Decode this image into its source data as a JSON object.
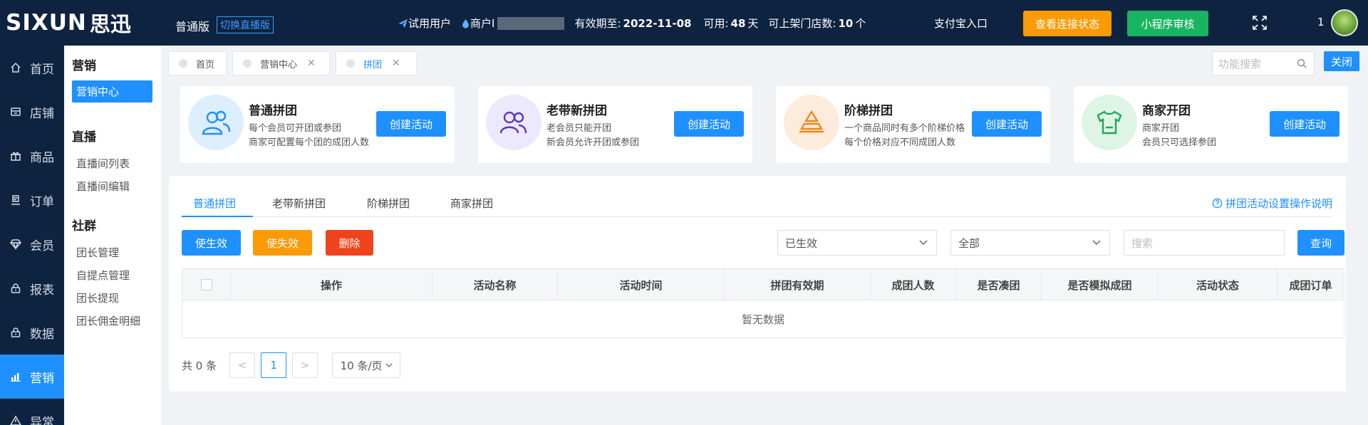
{
  "header": {
    "logo_text": "SIXUN",
    "logo_cn": "思迅",
    "edition": "普通版",
    "switch_link": "切换直播版",
    "trial_user": "试用用户",
    "merchant_label": "商户I",
    "expiry_label": "有效期至:",
    "expiry_value": "2022-11-08",
    "available_label": "可用:",
    "available_value": "48",
    "available_unit": "天",
    "stores_label": "可上架门店数:",
    "stores_value": "10",
    "stores_unit": "个",
    "alipay_entry": "支付宝入口",
    "status_button": "查看连接状态",
    "miniprogram_button": "小程序审核",
    "user_number": "1"
  },
  "sidenav": [
    {
      "label": "首页",
      "icon": "home-icon"
    },
    {
      "label": "店铺",
      "icon": "store-icon"
    },
    {
      "label": "商品",
      "icon": "gift-icon"
    },
    {
      "label": "订单",
      "icon": "order-icon"
    },
    {
      "label": "会员",
      "icon": "diamond-icon"
    },
    {
      "label": "报表",
      "icon": "lock-icon"
    },
    {
      "label": "数据",
      "icon": "lock-icon"
    },
    {
      "label": "营销",
      "icon": "bar-chart-icon",
      "active": true
    },
    {
      "label": "异常",
      "icon": "warning-icon"
    }
  ],
  "subnav": {
    "group1": "营销",
    "marketing_center": "营销中心",
    "group2": "直播",
    "live_list": "直播间列表",
    "live_edit": "直播间编辑",
    "group3": "社群",
    "leader_manage": "团长管理",
    "pickup_manage": "自提点管理",
    "leader_withdraw": "团长提现",
    "leader_commission": "团长佣金明细"
  },
  "tabs": {
    "home": "首页",
    "marketing": "营销中心",
    "group": "拼团",
    "close_mark": "✕",
    "function_search_placeholder": "功能搜索",
    "close_button": "关闭"
  },
  "cards": [
    {
      "title": "普通拼团",
      "desc1": "每个会员可开团或参团",
      "desc2": "商家可配置每个团的成团人数",
      "button": "创建活动"
    },
    {
      "title": "老带新拼团",
      "desc1": "老会员只能开团",
      "desc2": "新会员允许开团或参团",
      "button": "创建活动"
    },
    {
      "title": "阶梯拼团",
      "desc1": "一个商品同时有多个阶梯价格",
      "desc2": "每个价格对应不同成团人数",
      "button": "创建活动"
    },
    {
      "title": "商家开团",
      "desc1": "商家开团",
      "desc2": "会员只可选择参团",
      "button": "创建活动"
    }
  ],
  "panel": {
    "tabs": [
      "普通拼团",
      "老带新拼团",
      "阶梯拼团",
      "商家拼团"
    ],
    "help_link": "拼团活动设置操作说明",
    "btn_enable": "使生效",
    "btn_disable": "使失效",
    "btn_delete": "删除",
    "status_select": "已生效",
    "type_select": "全部",
    "search_placeholder": "搜索",
    "query_button": "查询",
    "columns": [
      "操作",
      "活动名称",
      "活动时间",
      "拼团有效期",
      "成团人数",
      "是否凑团",
      "是否模拟成团",
      "活动状态",
      "成团订单"
    ],
    "empty_text": "暂无数据",
    "total_text": "共 0 条",
    "prev": "<",
    "current_page": "1",
    "next": ">",
    "page_size": "10 条/页"
  },
  "colors": {
    "primary": "#1e90ff",
    "nav_bg": "#0e2340",
    "orange": "#fa9a06",
    "green": "#19b461",
    "red": "#f0421c"
  }
}
